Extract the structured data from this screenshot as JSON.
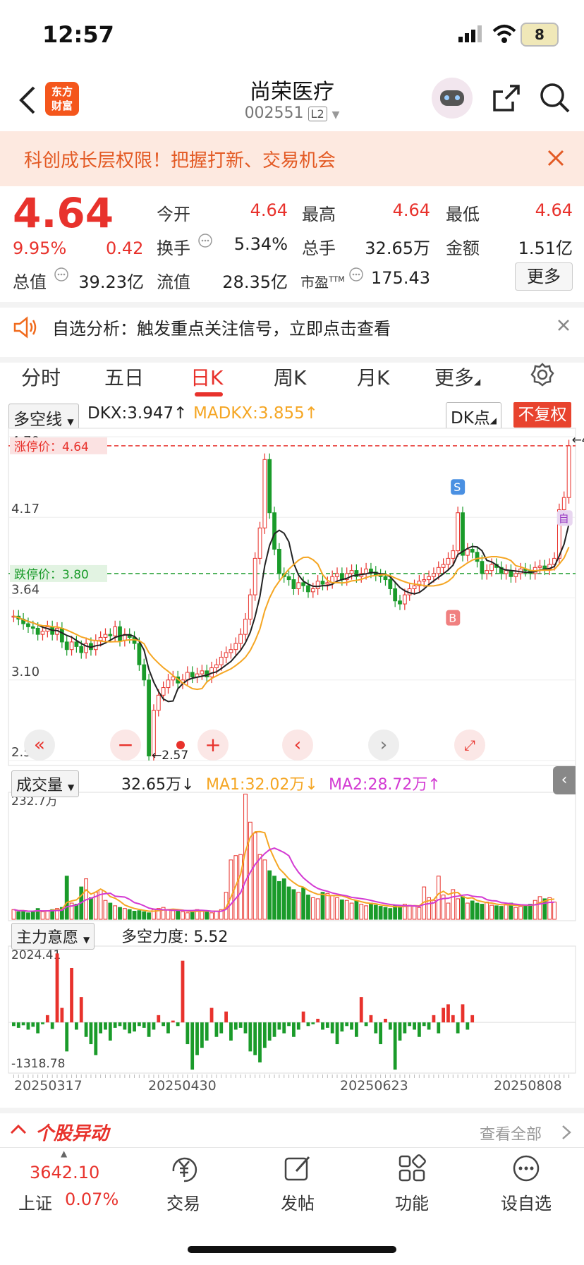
{
  "status_bar": {
    "time": "12:57",
    "battery": "8"
  },
  "header": {
    "title": "尚荣医疗",
    "code": "002551",
    "level_badge": "L2"
  },
  "banner": {
    "text": "科创成长层权限！把握打新、交易机会"
  },
  "quote": {
    "price": "4.64",
    "change_pct": "9.95%",
    "change": "0.42",
    "open_label": "今开",
    "open": "4.64",
    "high_label": "最高",
    "high": "4.64",
    "low_label": "最低",
    "low": "4.64",
    "turnover_label": "换手",
    "turnover": "5.34%",
    "volume_label": "总手",
    "volume": "32.65万",
    "amount_label": "金额",
    "amount": "1.51亿",
    "mcap_label": "总值",
    "mcap": "39.23亿",
    "float_label": "流值",
    "float_cap": "28.35亿",
    "pe_label": "市盈",
    "pe_sup": "TTM",
    "pe": "175.43",
    "more_label": "更多"
  },
  "notice": {
    "text": "自选分析：触发重点关注信号，立即点击查看"
  },
  "tabs": [
    {
      "label": "分时"
    },
    {
      "label": "五日"
    },
    {
      "label": "日K"
    },
    {
      "label": "周K"
    },
    {
      "label": "月K"
    },
    {
      "label": "更多"
    }
  ],
  "chart_toolbar": {
    "indicator": "多空线",
    "dkx": "DKX:3.947↑",
    "madkx": "MADKX:3.855↑",
    "dk_point": "DK点",
    "fq": "不复权"
  },
  "colors": {
    "up": "#e8322c",
    "down": "#1a9b2a",
    "ma1": "#f5a623",
    "ma2": "#d33ad3",
    "accent": "#e8322c"
  },
  "chart_data": [
    {
      "type": "candlestick",
      "y_labels": [
        "4.70",
        "4.17",
        "3.64",
        "3.10",
        "2.57"
      ],
      "ylim": [
        2.57,
        4.7
      ],
      "limit_up_label": "涨停价：4.64",
      "limit_down_label": "跌停价：3.80",
      "max_label": "4.70",
      "min_label": "2.57",
      "signal_sell": "S",
      "signal_buy": "B",
      "signal_self": "自",
      "series": [
        {
          "name": "DKX",
          "color": "#222222"
        },
        {
          "name": "MADKX",
          "color": "#f5a623"
        }
      ],
      "close": [
        3.52,
        3.5,
        3.47,
        3.45,
        3.44,
        3.4,
        3.42,
        3.45,
        3.4,
        3.44,
        3.35,
        3.3,
        3.35,
        3.32,
        3.28,
        3.34,
        3.3,
        3.36,
        3.38,
        3.4,
        3.39,
        3.45,
        3.36,
        3.4,
        3.38,
        3.34,
        3.2,
        3.1,
        2.6,
        2.9,
        3.0,
        3.05,
        3.1,
        3.12,
        3.08,
        3.1,
        3.15,
        3.12,
        3.14,
        3.16,
        3.12,
        3.18,
        3.2,
        3.25,
        3.28,
        3.3,
        3.34,
        3.4,
        3.5,
        3.66,
        3.9,
        4.1,
        4.55,
        4.2,
        3.96,
        3.8,
        3.78,
        3.76,
        3.7,
        3.74,
        3.72,
        3.68,
        3.7,
        3.75,
        3.73,
        3.74,
        3.78,
        3.8,
        3.76,
        3.8,
        3.82,
        3.78,
        3.8,
        3.83,
        3.81,
        3.79,
        3.78,
        3.76,
        3.7,
        3.62,
        3.6,
        3.66,
        3.7,
        3.72,
        3.75,
        3.76,
        3.78,
        3.8,
        3.84,
        3.86,
        3.9,
        3.95,
        4.2,
        3.92,
        3.96,
        3.94,
        3.88,
        3.8,
        3.82,
        3.86,
        3.84,
        3.8,
        3.82,
        3.78,
        3.8,
        3.83,
        3.82,
        3.8,
        3.84,
        3.85,
        3.83,
        3.86,
        3.9,
        4.22,
        4.3,
        4.64
      ]
    },
    {
      "type": "bar",
      "name": "成交量",
      "value_label": "32.65万↓",
      "ma1_label": "MA1:32.02万↓",
      "ma2_label": "MA2:28.72万↑",
      "y_max_label": "232.7万",
      "ylim": [
        0,
        232.7
      ],
      "values": [
        18,
        14,
        16,
        12,
        15,
        20,
        14,
        16,
        18,
        20,
        22,
        80,
        30,
        28,
        60,
        75,
        40,
        50,
        55,
        35,
        30,
        25,
        22,
        20,
        18,
        15,
        16,
        14,
        12,
        18,
        20,
        22,
        18,
        16,
        15,
        14,
        12,
        15,
        18,
        16,
        14,
        12,
        15,
        18,
        50,
        110,
        118,
        120,
        232,
        180,
        160,
        120,
        110,
        90,
        80,
        70,
        75,
        60,
        55,
        50,
        58,
        45,
        40,
        38,
        50,
        48,
        44,
        40,
        36,
        35,
        30,
        34,
        28,
        25,
        30,
        26,
        24,
        22,
        20,
        25,
        24,
        28,
        26,
        24,
        22,
        60,
        40,
        35,
        80,
        45,
        30,
        55,
        38,
        42,
        30,
        34,
        30,
        28,
        32,
        26,
        25,
        24,
        28,
        30,
        22,
        24,
        26,
        28,
        35,
        42,
        38,
        40,
        32
      ]
    },
    {
      "type": "bar",
      "name": "主力意愿",
      "force_label": "多空力度: 5.52",
      "y_max_label": "2024.41",
      "y_min_label": "-1318.78",
      "ylim": [
        -1318.78,
        2024.41
      ],
      "x_labels": [
        "20250317",
        "20250430",
        "20250623",
        "20250808"
      ],
      "values": [
        -100,
        -150,
        -80,
        -200,
        -120,
        -300,
        -50,
        200,
        -180,
        1900,
        400,
        -800,
        1500,
        -200,
        700,
        -400,
        -600,
        -900,
        -300,
        -200,
        -500,
        -150,
        -100,
        -200,
        -300,
        -250,
        -100,
        -150,
        -400,
        -200,
        200,
        -100,
        -300,
        50,
        -100,
        1700,
        -600,
        -1300,
        -900,
        -700,
        -500,
        400,
        -400,
        -300,
        300,
        -500,
        -200,
        -150,
        -300,
        -800,
        -900,
        -1100,
        -700,
        -500,
        -400,
        -200,
        -300,
        -100,
        -400,
        -200,
        300,
        -100,
        -50,
        100,
        -200,
        -150,
        -300,
        -600,
        -250,
        -100,
        -200,
        -400,
        700,
        -100,
        200,
        -300,
        -600,
        100,
        -200,
        -1300,
        -500,
        -300,
        -100,
        -200,
        -400,
        -100,
        -200,
        200,
        -300,
        400,
        500,
        200,
        -300,
        500,
        -200,
        200
      ]
    }
  ],
  "volume_indicator": "成交量",
  "force_indicator": "主力意愿",
  "anomaly": {
    "title": "个股异动",
    "view_all": "查看全部"
  },
  "index": {
    "value": "3642.10",
    "name": "上证",
    "change": "0.07%"
  },
  "bottom_nav": [
    {
      "label": "交易",
      "icon": "trade-icon"
    },
    {
      "label": "发帖",
      "icon": "post-icon"
    },
    {
      "label": "功能",
      "icon": "grid-icon"
    },
    {
      "label": "设自选",
      "icon": "add-favorite-icon"
    }
  ]
}
